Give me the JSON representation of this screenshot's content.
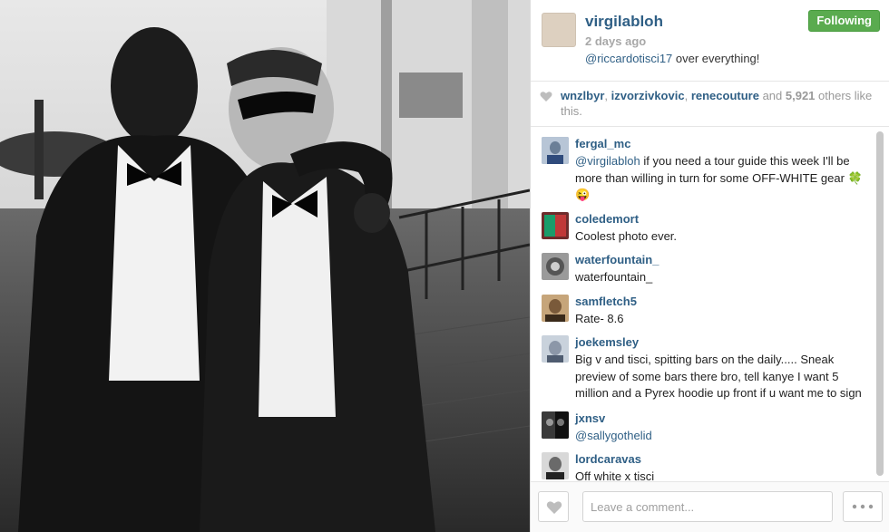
{
  "post": {
    "username": "virgilabloh",
    "time": "2 days ago",
    "follow_label": "Following",
    "caption_mention": "@riccardotisci17",
    "caption_text": " over everything!"
  },
  "likes": {
    "user1": "wnzlbyr",
    "sep1": ", ",
    "user2": "izvorzivkovic",
    "sep2": ", ",
    "user3": "renecouture",
    "and_text": " and ",
    "count": "5,921",
    "others_text": " others like this."
  },
  "comments": [
    {
      "user": "fergal_mc",
      "mention": "@virgilabloh",
      "text": " if you need a tour guide this week I'll be more than willing in turn for some OFF-WHITE gear 🍀 😜"
    },
    {
      "user": "coledemort",
      "text": "Coolest photo ever."
    },
    {
      "user": "waterfountain_",
      "text": "waterfountain_"
    },
    {
      "user": "samfletch5",
      "text": "Rate- 8.6"
    },
    {
      "user": "joekemsley",
      "text": "Big v and tisci, spitting bars on the daily..... Sneak preview of some bars there bro, tell kanye I want 5 million and a Pyrex hoodie up front if u want me to sign"
    },
    {
      "user": "jxnsv",
      "mention": "@sallygothelid",
      "text": ""
    },
    {
      "user": "lordcaravas",
      "text": "Off white x tisci"
    }
  ],
  "footer": {
    "comment_placeholder": "Leave a comment..."
  },
  "icons": {
    "heart": "heart-icon",
    "more": "more-dots-icon"
  },
  "colors": {
    "link": "#2f5f85",
    "follow_green": "#5aab4f",
    "muted": "#a8a8a8"
  }
}
